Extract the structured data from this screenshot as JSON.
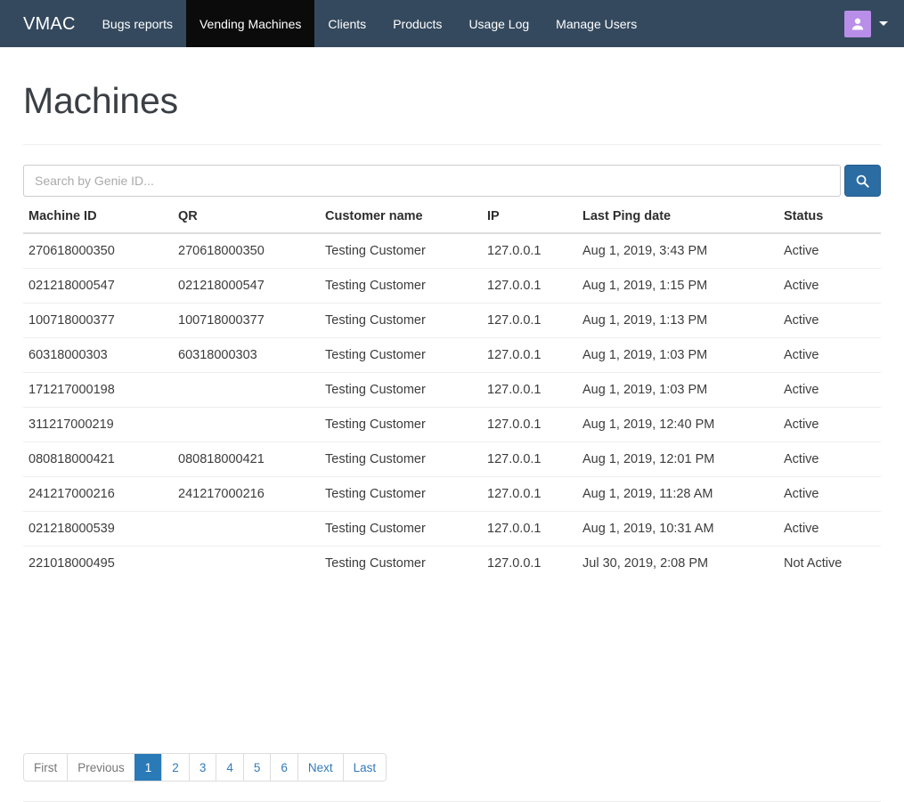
{
  "navbar": {
    "brand": "VMAC",
    "items": [
      {
        "label": "Bugs reports",
        "active": false
      },
      {
        "label": "Vending Machines",
        "active": true
      },
      {
        "label": "Clients",
        "active": false
      },
      {
        "label": "Products",
        "active": false
      },
      {
        "label": "Usage Log",
        "active": false
      },
      {
        "label": "Manage Users",
        "active": false
      }
    ],
    "avatar_icon": "user-icon",
    "dropdown_icon": "caret-down-icon",
    "background_color": "#34495e",
    "active_background_color": "#0b0b0b",
    "avatar_color": "#b98ee8"
  },
  "page": {
    "title": "Machines"
  },
  "search": {
    "value": "",
    "placeholder": "Search by Genie ID...",
    "button_icon": "search-icon",
    "button_color": "#2b6ca3"
  },
  "table": {
    "columns": [
      "Machine ID",
      "QR",
      "Customer name",
      "IP",
      "Last Ping date",
      "Status"
    ],
    "rows": [
      {
        "machine_id": "270618000350",
        "qr": "270618000350",
        "customer": "Testing Customer",
        "ip": "127.0.0.1",
        "last_ping": "Aug 1, 2019, 3:43 PM",
        "status": "Active"
      },
      {
        "machine_id": "021218000547",
        "qr": "021218000547",
        "customer": "Testing Customer",
        "ip": "127.0.0.1",
        "last_ping": "Aug 1, 2019, 1:15 PM",
        "status": "Active"
      },
      {
        "machine_id": "100718000377",
        "qr": "100718000377",
        "customer": "Testing Customer",
        "ip": "127.0.0.1",
        "last_ping": "Aug 1, 2019, 1:13 PM",
        "status": "Active"
      },
      {
        "machine_id": "60318000303",
        "qr": "60318000303",
        "customer": "Testing Customer",
        "ip": "127.0.0.1",
        "last_ping": "Aug 1, 2019, 1:03 PM",
        "status": "Active"
      },
      {
        "machine_id": "171217000198",
        "qr": "",
        "customer": "Testing Customer",
        "ip": "127.0.0.1",
        "last_ping": "Aug 1, 2019, 1:03 PM",
        "status": "Active"
      },
      {
        "machine_id": "311217000219",
        "qr": "",
        "customer": "Testing Customer",
        "ip": "127.0.0.1",
        "last_ping": "Aug 1, 2019, 12:40 PM",
        "status": "Active"
      },
      {
        "machine_id": "080818000421",
        "qr": "080818000421",
        "customer": "Testing Customer",
        "ip": "127.0.0.1",
        "last_ping": "Aug 1, 2019, 12:01 PM",
        "status": "Active"
      },
      {
        "machine_id": "241217000216",
        "qr": "241217000216",
        "customer": "Testing Customer",
        "ip": "127.0.0.1",
        "last_ping": "Aug 1, 2019, 11:28 AM",
        "status": "Active"
      },
      {
        "machine_id": "021218000539",
        "qr": "",
        "customer": "Testing Customer",
        "ip": "127.0.0.1",
        "last_ping": "Aug 1, 2019, 10:31 AM",
        "status": "Active"
      },
      {
        "machine_id": "221018000495",
        "qr": "",
        "customer": "Testing Customer",
        "ip": "127.0.0.1",
        "last_ping": "Jul 30, 2019, 2:08 PM",
        "status": "Not Active"
      }
    ]
  },
  "pagination": {
    "first": "First",
    "previous": "Previous",
    "pages": [
      "1",
      "2",
      "3",
      "4",
      "5",
      "6"
    ],
    "current_page": "1",
    "next": "Next",
    "last": "Last",
    "active_color": "#2b7ab8",
    "link_color": "#337ab7"
  }
}
